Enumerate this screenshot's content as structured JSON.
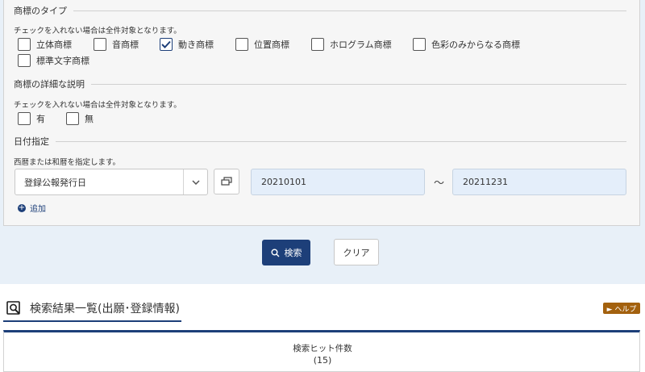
{
  "trademark_type": {
    "title": "商標のタイプ",
    "note": "チェックを入れない場合は全件対象となります。",
    "options": [
      {
        "label": "立体商標",
        "checked": false
      },
      {
        "label": "音商標",
        "checked": false
      },
      {
        "label": "動き商標",
        "checked": true
      },
      {
        "label": "位置商標",
        "checked": false
      },
      {
        "label": "ホログラム商標",
        "checked": false
      },
      {
        "label": "色彩のみからなる商標",
        "checked": false
      },
      {
        "label": "標準文字商標",
        "checked": false
      }
    ]
  },
  "detail": {
    "title": "商標の詳細な説明",
    "note": "チェックを入れない場合は全件対象となります。",
    "options": [
      {
        "label": "有",
        "checked": false
      },
      {
        "label": "無",
        "checked": false
      }
    ]
  },
  "date": {
    "title": "日付指定",
    "note": "西暦または和暦を指定します。",
    "select_value": "登録公報発行日",
    "from": "20210101",
    "separator": "～",
    "to": "20211231",
    "add_label": "追加"
  },
  "actions": {
    "search_label": "検索",
    "clear_label": "クリア"
  },
  "results": {
    "title": "検索結果一覧(出願･登録情報)",
    "help_label": "► ヘルプ",
    "hit_label": "検索ヒット件数",
    "hit_count": "(15)"
  },
  "colors": {
    "primary": "#1d3f79",
    "help": "#a3610e",
    "date_input_bg": "#e4eefa"
  }
}
